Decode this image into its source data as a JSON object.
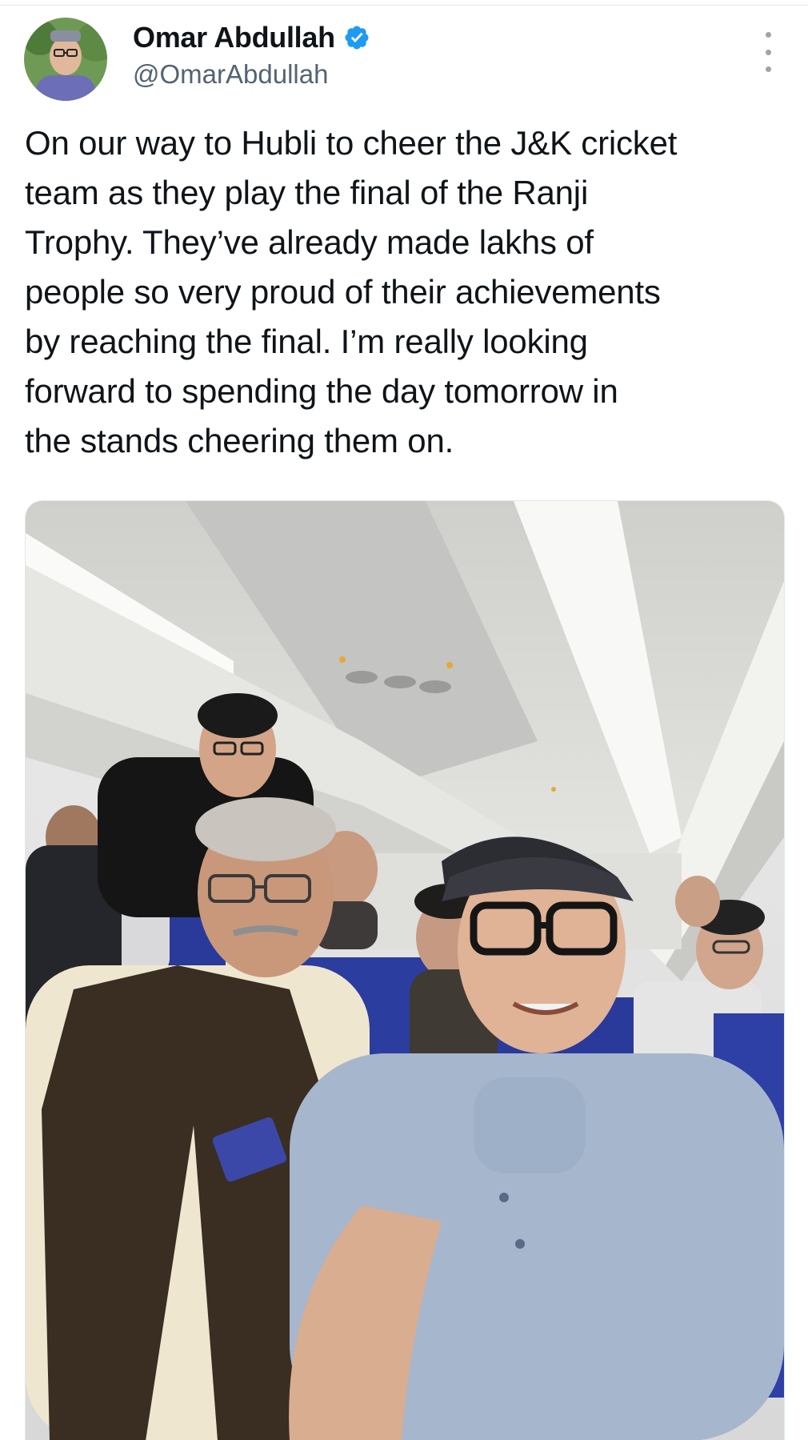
{
  "author": {
    "display_name": "Omar Abdullah",
    "handle": "@OmarAbdullah",
    "verified": true
  },
  "tweet": {
    "text": "On our way to Hubli to cheer the J&K cricket\nteam as they play the final of the Ranji\nTrophy. They’ve already made lakhs of\npeople so very proud of their achievements\nby reaching the final. I’m really looking\nforward to spending the day tomorrow in\nthe stands cheering them on."
  },
  "media": {
    "kind": "photo"
  },
  "colors": {
    "verified_badge": "#1d9bf0",
    "name_text": "#0f1419",
    "handle_text": "#536471",
    "seat_blue": "#2a3a9a"
  },
  "icons": {
    "verified": "verified-badge-icon",
    "more": "more-vertical-icon"
  }
}
